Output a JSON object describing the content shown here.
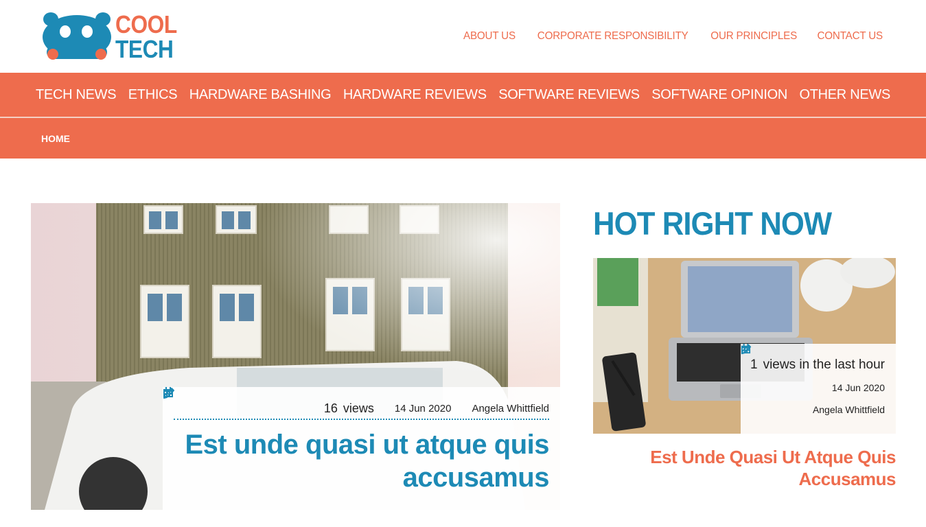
{
  "logo": {
    "line1": "COOL",
    "line2": "TECH"
  },
  "topnav": [
    {
      "label": "ABOUT US"
    },
    {
      "label": "CORPORATE RESPONSIBILITY"
    },
    {
      "label": "OUR PRINCIPLES"
    },
    {
      "label": "CONTACT US"
    }
  ],
  "mainnav": [
    {
      "label": "TECH NEWS"
    },
    {
      "label": "ETHICS"
    },
    {
      "label": "HARDWARE BASHING"
    },
    {
      "label": "HARDWARE REVIEWS"
    },
    {
      "label": "SOFTWARE REVIEWS"
    },
    {
      "label": "SOFTWARE OPINION"
    },
    {
      "label": "OTHER NEWS"
    }
  ],
  "breadcrumb": {
    "home": "HOME"
  },
  "feature": {
    "views_count": "16",
    "views_label": "views",
    "date": "14 Jun 2020",
    "author": "Angela Whittfield",
    "title": "Est unde quasi ut atque quis accusamus"
  },
  "sidebar": {
    "heading": "HOT RIGHT NOW",
    "views_count": "1",
    "views_label": "views in the last hour",
    "date": "14 Jun 2020",
    "author": "Angela Whittfield",
    "title": "Est Unde Quasi Ut Atque Quis Accusamus"
  },
  "colors": {
    "accent": "#ee6c4d",
    "brand_blue": "#1d8ab5"
  },
  "icons": {
    "date": "calendar-icon",
    "author": "pencil-icon"
  }
}
